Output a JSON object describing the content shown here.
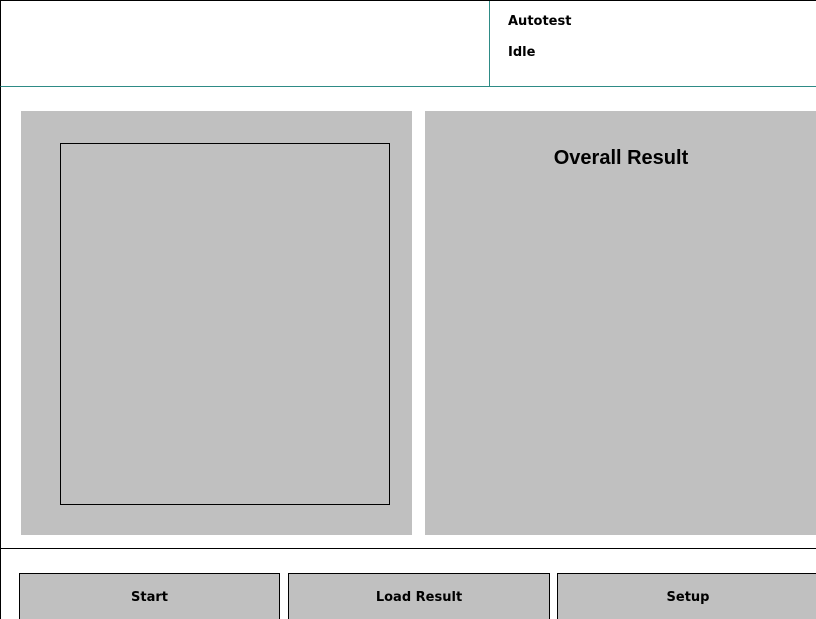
{
  "header": {
    "mode": "Autotest",
    "state": "Idle"
  },
  "result_panel": {
    "title": "Overall Result"
  },
  "footer": {
    "buttons": {
      "start": "Start",
      "load_result": "Load Result",
      "setup": "Setup"
    }
  },
  "colors": {
    "panel": "#c0c0c0",
    "header_rule": "#2e8b86",
    "background": "#ffffff"
  }
}
